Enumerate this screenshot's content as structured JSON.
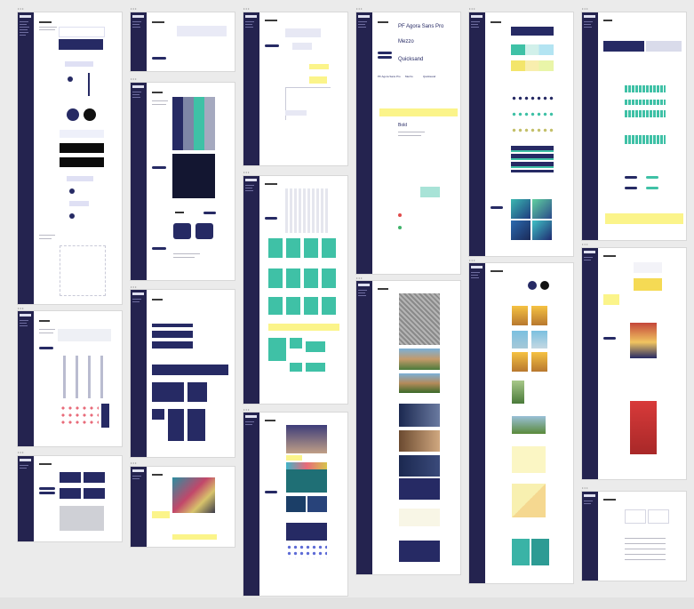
{
  "canvas": {
    "background": "#ebebeb"
  },
  "frames": [
    {
      "id": "f1",
      "title": "• • •"
    },
    {
      "id": "f2",
      "title": "• • •"
    },
    {
      "id": "f3",
      "title": "• • •"
    },
    {
      "id": "f4",
      "title": "• • •"
    },
    {
      "id": "f5",
      "title": "• • •"
    },
    {
      "id": "f6",
      "title": "• • •"
    },
    {
      "id": "f7",
      "title": "• • •"
    },
    {
      "id": "f8",
      "title": "• • •"
    },
    {
      "id": "f9",
      "title": "• • •"
    },
    {
      "id": "f10",
      "title": "• • •"
    },
    {
      "id": "f11",
      "title": "• • •"
    },
    {
      "id": "f12",
      "title": "• • •"
    },
    {
      "id": "f13",
      "title": "• • •"
    },
    {
      "id": "f14",
      "title": "• • •"
    },
    {
      "id": "f15",
      "title": "• • •"
    },
    {
      "id": "f16",
      "title": "• • •"
    },
    {
      "id": "f17",
      "title": "• • •"
    },
    {
      "id": "f18",
      "title": "• • •"
    }
  ],
  "typography": {
    "font_1": "PF Agora Sans Pro",
    "font_2": "Mezzo",
    "font_3": "Quicksand",
    "sample_small": "PF Agora Sans Pro",
    "sample_2": "Mezzo",
    "sample_3": "Quicksand",
    "sample_4": "Bold"
  },
  "brand": {
    "primary": "#262a64",
    "accent": "#3fc1a6",
    "highlight": "#fbf48a",
    "sidebar": "#24234f"
  }
}
